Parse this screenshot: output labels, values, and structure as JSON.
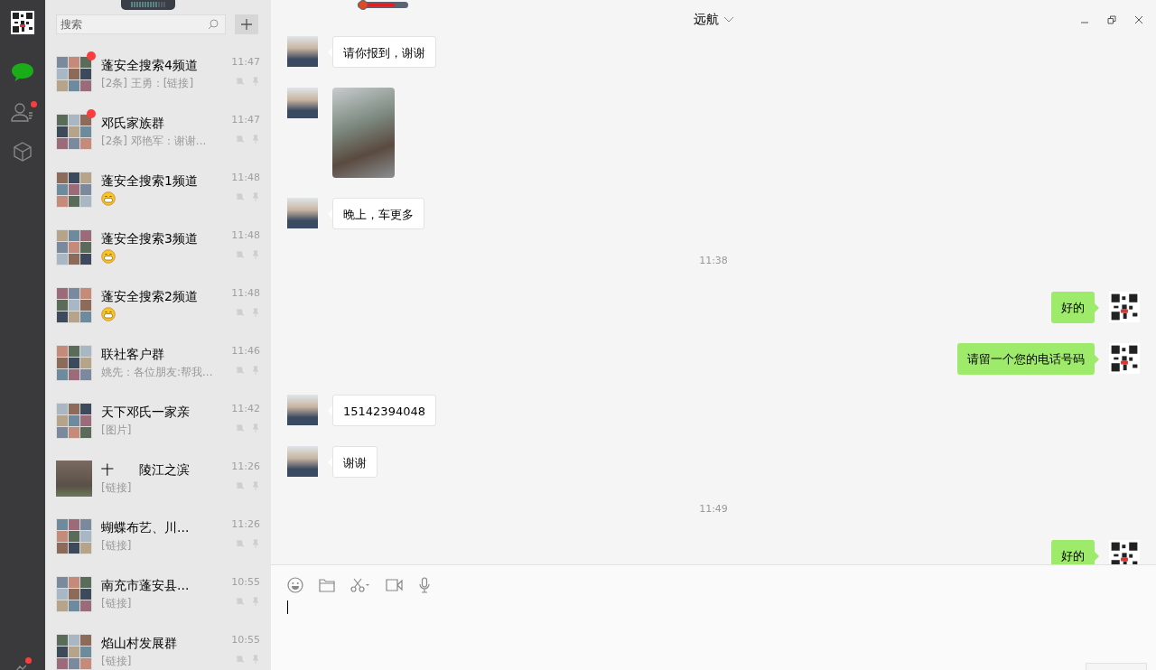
{
  "nav": {
    "items": [
      {
        "kind": "chats",
        "selected": true,
        "badge": false
      },
      {
        "kind": "contacts",
        "selected": false,
        "badge": true
      },
      {
        "kind": "favorites",
        "selected": false,
        "badge": false
      }
    ],
    "bottom_badge": true
  },
  "search": {
    "placeholder": "搜索"
  },
  "conversations": [
    {
      "name": "蓬安全搜索4频道",
      "preview": {
        "kind": "text",
        "text": "[2条] 王勇：[链接]"
      },
      "time": "11:47",
      "unread": true,
      "avatar": {
        "kind": "group"
      }
    },
    {
      "name": "邓氏家族群",
      "preview": {
        "kind": "text",
        "text": "[2条] 邓艳军：谢谢..."
      },
      "time": "11:47",
      "unread": true,
      "avatar": {
        "kind": "group"
      }
    },
    {
      "name": "蓬安全搜索1频道",
      "preview": {
        "kind": "emoji"
      },
      "time": "11:48",
      "unread": false,
      "avatar": {
        "kind": "group"
      }
    },
    {
      "name": "蓬安全搜索3频道",
      "preview": {
        "kind": "emoji"
      },
      "time": "11:48",
      "unread": false,
      "avatar": {
        "kind": "group"
      }
    },
    {
      "name": "蓬安全搜索2频道",
      "preview": {
        "kind": "emoji"
      },
      "time": "11:48",
      "unread": false,
      "avatar": {
        "kind": "group"
      }
    },
    {
      "name": "联社客户群",
      "preview": {
        "kind": "text",
        "text": "姚先：各位朋友:帮我..."
      },
      "time": "11:46",
      "unread": false,
      "avatar": {
        "kind": "group"
      }
    },
    {
      "name": "天下邓氏一家亲",
      "preview": {
        "kind": "text",
        "text": "[图片]"
      },
      "time": "11:42",
      "unread": false,
      "avatar": {
        "kind": "group"
      }
    },
    {
      "name": "十　　陵江之滨",
      "preview": {
        "kind": "text",
        "text": "[链接]"
      },
      "time": "11:26",
      "unread": false,
      "avatar": {
        "kind": "photo"
      }
    },
    {
      "name": "蝴蝶布艺、川...",
      "preview": {
        "kind": "text",
        "text": "[链接]"
      },
      "time": "11:26",
      "unread": false,
      "avatar": {
        "kind": "group"
      }
    },
    {
      "name": "南充市蓬安县...",
      "preview": {
        "kind": "text",
        "text": "[链接]"
      },
      "time": "10:55",
      "unread": false,
      "avatar": {
        "kind": "group"
      }
    },
    {
      "name": "焰山村发展群",
      "preview": {
        "kind": "text",
        "text": "[链接]"
      },
      "time": "10:55",
      "unread": false,
      "avatar": {
        "kind": "group"
      }
    }
  ],
  "chat": {
    "title": "远航",
    "messages": [
      {
        "kind": "text",
        "outgoing": false,
        "text": "请你报到，谢谢"
      },
      {
        "kind": "image",
        "outgoing": false
      },
      {
        "kind": "text",
        "outgoing": false,
        "text": "晚上，车更多"
      },
      {
        "kind": "time",
        "text": "11:38"
      },
      {
        "kind": "text",
        "outgoing": true,
        "text": "好的"
      },
      {
        "kind": "text",
        "outgoing": true,
        "text": "请留一个您的电话号码"
      },
      {
        "kind": "text",
        "outgoing": false,
        "text": "15142394048"
      },
      {
        "kind": "text",
        "outgoing": false,
        "text": "谢谢"
      },
      {
        "kind": "time",
        "text": "11:49"
      },
      {
        "kind": "text",
        "outgoing": true,
        "text": "好的"
      }
    ]
  }
}
